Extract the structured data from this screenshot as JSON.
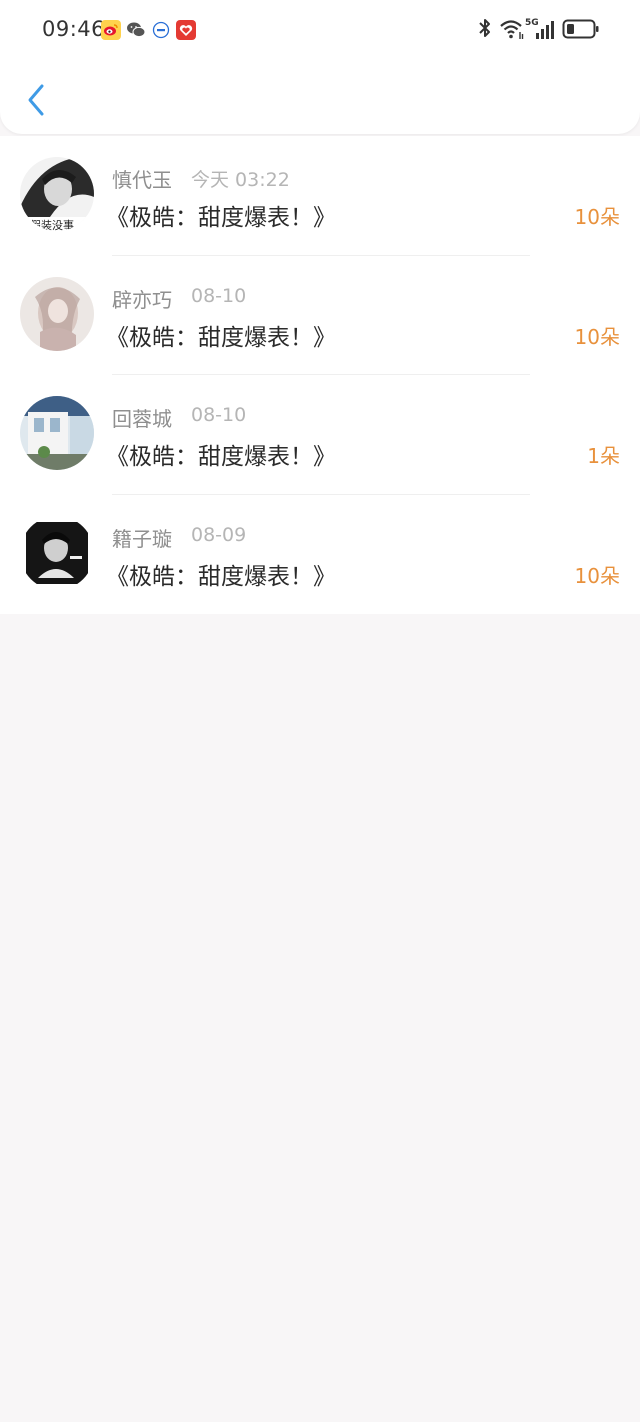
{
  "status_bar": {
    "time": "09:46",
    "notification_icons": [
      "weibo-icon",
      "wechat-icon",
      "ifly-icon",
      "app-heart-icon"
    ],
    "right_icons": [
      "bluetooth-icon",
      "wifi-icon",
      "signal-5g-icon",
      "battery-icon"
    ],
    "signal_label": "5G"
  },
  "nav": {
    "back_icon": "chevron-left-icon",
    "accent_color": "#3f9be6"
  },
  "colors": {
    "amount": "#e8913c",
    "name": "#8f8f8f",
    "date": "#b5b5b5",
    "title": "#2b2b2b",
    "page_bg": "#f8f6f7"
  },
  "records": [
    {
      "name": "慎代玉",
      "date": "今天 03:22",
      "title": "《极皓：甜度爆表！》",
      "amount": "10朵",
      "avatar_icon": "avatar-image"
    },
    {
      "name": "辟亦巧",
      "date": "08-10",
      "title": "《极皓：甜度爆表！》",
      "amount": "10朵",
      "avatar_icon": "avatar-image"
    },
    {
      "name": "回蓉城",
      "date": "08-10",
      "title": "《极皓：甜度爆表！》",
      "amount": "1朵",
      "avatar_icon": "avatar-image"
    },
    {
      "name": "籍子璇",
      "date": "08-09",
      "title": "《极皓：甜度爆表！》",
      "amount": "10朵",
      "avatar_icon": "avatar-image"
    }
  ]
}
